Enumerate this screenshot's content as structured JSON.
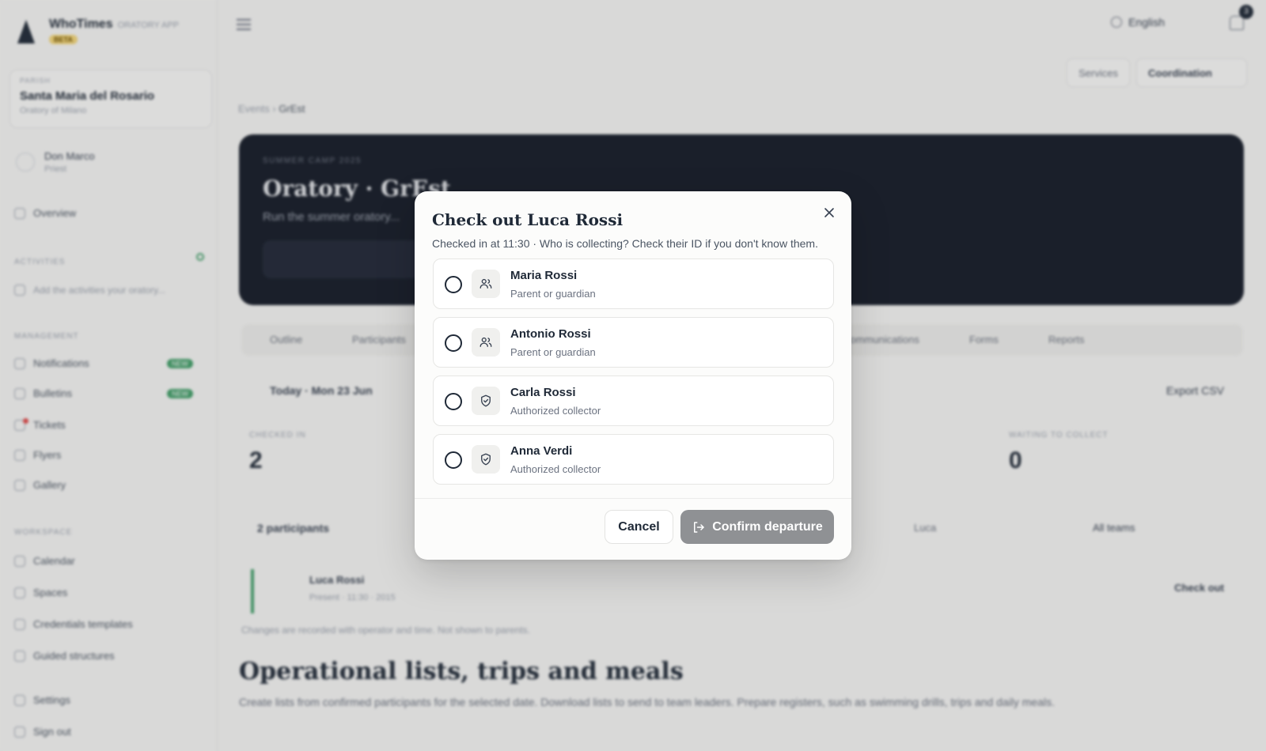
{
  "app": {
    "brand_name": "WhoTimes",
    "brand_sub": "ORATORY APP",
    "brand_tag": "BETA",
    "parish_label": "Parish",
    "parish_name": "Santa Maria del Rosario",
    "parish_city": "Oratory of Milano",
    "user_name": "Don Marco",
    "user_role": "Priest",
    "nav_overview": "Overview",
    "section_activities": "Activities",
    "activity_item": "Add the activities your oratory...",
    "section_management": "Management",
    "nav_notifications": "Notifications",
    "nav_bulletins": "Bulletins",
    "nav_tickets": "Tickets",
    "nav_flyers": "Flyers",
    "nav_gallery": "Gallery",
    "new_badge": "NEW",
    "section_workspace": "Workspace",
    "nav_calendar": "Calendar",
    "nav_spaces": "Spaces",
    "nav_credentials": "Credentials templates",
    "nav_guides": "Guided structures",
    "nav_settings": "Settings",
    "nav_signout": "Sign out"
  },
  "topbar": {
    "language": "English",
    "notif_count": "3",
    "btn_services": "Services",
    "btn_coordination": "Coordination"
  },
  "breadcrumb": {
    "parent": "Events",
    "current": "GrEst"
  },
  "hero": {
    "kicker": "Summer camp 2025",
    "title": "Oratory · GrEst",
    "subtitle": "Run the summer oratory..."
  },
  "tabs": [
    "Outline",
    "Participants",
    "Communications",
    "Forms",
    "Reports"
  ],
  "filter": {
    "date_label": "Today · Mon 23 Jun",
    "export": "Export CSV"
  },
  "stats": [
    {
      "label": "Checked in",
      "value": "2"
    },
    {
      "label": "Waiting to collect",
      "value": "0"
    }
  ],
  "list": {
    "title": "2 participants",
    "search": "Luca",
    "team_filter": "All teams",
    "row_name": "Luca Rossi",
    "row_meta": "Present · 11:30 · 2015",
    "row_action": "Check out"
  },
  "note": "Changes are recorded with operator and time. Not shown to parents.",
  "section": {
    "title": "Operational lists, trips and meals",
    "desc": "Create lists from confirmed participants for the selected date. Download lists to send to team leaders. Prepare registers, such as swimming drills, trips and daily meals."
  },
  "modal": {
    "title": "Check out Luca Rossi",
    "subtitle": "Checked in at 11:30 · Who is collecting? Check their ID if you don't know them.",
    "options": [
      {
        "name": "Maria Rossi",
        "role": "Parent or guardian",
        "icon": "users-icon"
      },
      {
        "name": "Antonio Rossi",
        "role": "Parent or guardian",
        "icon": "users-icon"
      },
      {
        "name": "Carla Rossi",
        "role": "Authorized collector",
        "icon": "shield-check-icon"
      },
      {
        "name": "Anna Verdi",
        "role": "Authorized collector",
        "icon": "shield-check-icon"
      }
    ],
    "cancel_label": "Cancel",
    "confirm_label": "Confirm departure"
  }
}
